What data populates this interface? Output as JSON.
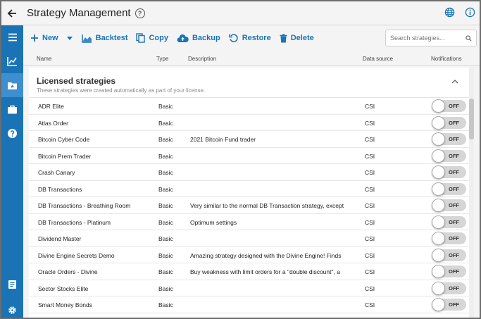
{
  "header": {
    "title": "Strategy Management",
    "help": "?"
  },
  "icons": {
    "back": "arrow-left-icon",
    "help": "help-circle-icon",
    "language": "globe-icon",
    "info": "info-icon"
  },
  "sidebar": {
    "items": [
      {
        "icon": "menu-icon"
      },
      {
        "icon": "chart-icon"
      },
      {
        "icon": "strategy-folder-icon"
      },
      {
        "icon": "briefcase-icon"
      },
      {
        "icon": "help-icon"
      },
      {
        "icon": "document-icon"
      },
      {
        "icon": "gear-icon"
      }
    ]
  },
  "toolbar": {
    "new": "New",
    "backtest": "Backtest",
    "copy": "Copy",
    "backup": "Backup",
    "restore": "Restore",
    "delete": "Delete"
  },
  "search": {
    "placeholder": "Search strategies...",
    "value": ""
  },
  "columns": {
    "name": "Name",
    "type": "Type",
    "description": "Description",
    "data_source": "Data source",
    "notifications": "Notifications"
  },
  "group": {
    "title": "Licensed strategies",
    "subtitle": "These strategies were created automatically as part of your license."
  },
  "rows": [
    {
      "name": "ADR Elite",
      "type": "Basic",
      "description": "",
      "source": "CSI",
      "notify": "OFF"
    },
    {
      "name": "Atlas Order",
      "type": "Basic",
      "description": "",
      "source": "CSI",
      "notify": "OFF"
    },
    {
      "name": "Bitcoin Cyber Code",
      "type": "Basic",
      "description": "2021 Bitcoin Fund trader",
      "source": "CSI",
      "notify": "OFF"
    },
    {
      "name": "Bitcoin Prem Trader",
      "type": "Basic",
      "description": "",
      "source": "CSI",
      "notify": "OFF"
    },
    {
      "name": "Crash Canary",
      "type": "Basic",
      "description": "",
      "source": "CSI",
      "notify": "OFF"
    },
    {
      "name": "DB Transactions",
      "type": "Basic",
      "description": "",
      "source": "CSI",
      "notify": "OFF"
    },
    {
      "name": "DB Transactions - Breathing Room",
      "type": "Basic",
      "description": "Very similar to the normal DB Transaction strategy, except",
      "source": "CSI",
      "notify": "OFF"
    },
    {
      "name": "DB Transactions - Platinum",
      "type": "Basic",
      "description": "Optimum settings",
      "source": "CSI",
      "notify": "OFF"
    },
    {
      "name": "Dividend Master",
      "type": "Basic",
      "description": "",
      "source": "CSI",
      "notify": "OFF"
    },
    {
      "name": "Divine Engine Secrets Demo",
      "type": "Basic",
      "description": "Amazing strategy designed with the Divine Engine! Finds",
      "source": "CSI",
      "notify": "OFF"
    },
    {
      "name": "Oracle Orders - Divine",
      "type": "Basic",
      "description": "Buy weakness with limit orders for a \"double discount\", a",
      "source": "CSI",
      "notify": "OFF"
    },
    {
      "name": "Sector Stocks Elite",
      "type": "Basic",
      "description": "",
      "source": "CSI",
      "notify": "OFF"
    },
    {
      "name": "Smart Money Bonds",
      "type": "Basic",
      "description": "",
      "source": "CSI",
      "notify": "OFF"
    }
  ],
  "colors": {
    "accent": "#1a73b5",
    "sidebar": "#1a73b5",
    "sidebar_active": "#3d8fcf"
  }
}
